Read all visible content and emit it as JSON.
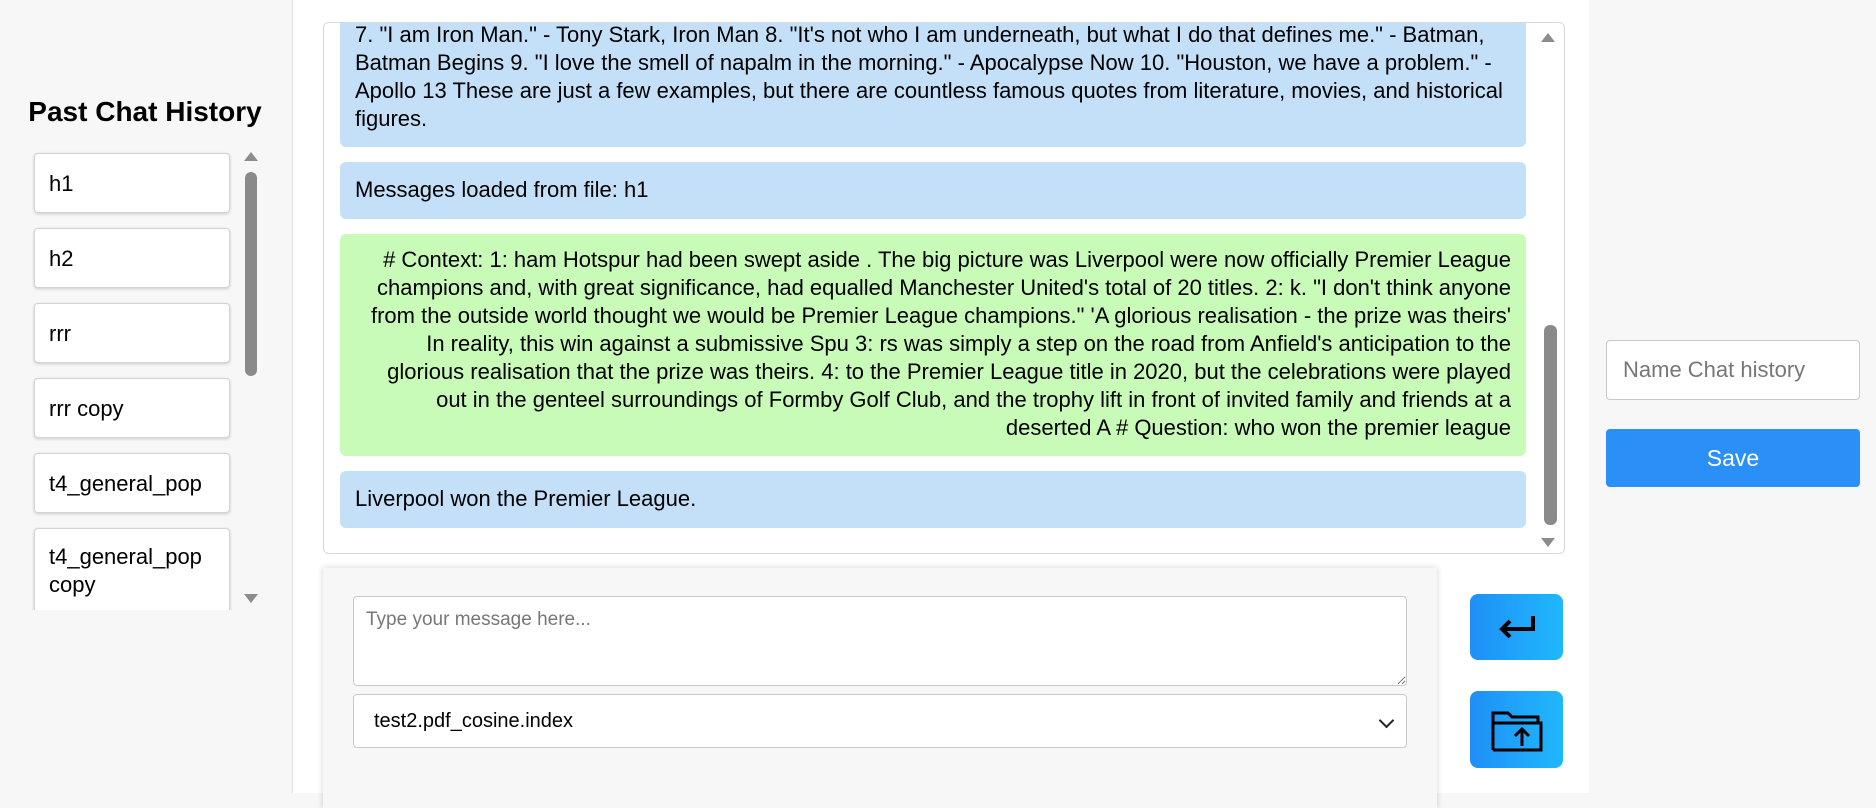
{
  "sidebar": {
    "title": "Past Chat History",
    "items": [
      {
        "label": "h1"
      },
      {
        "label": "h2"
      },
      {
        "label": "rrr"
      },
      {
        "label": "rrr copy"
      },
      {
        "label": "t4_general_pop"
      },
      {
        "label": "t4_general_pop copy"
      }
    ]
  },
  "chat": {
    "messages": [
      {
        "role": "bot",
        "text": "7. \"I am Iron Man.\" - Tony Stark, Iron Man 8. \"It's not who I am underneath, but what I do that defines me.\" - Batman, Batman Begins 9. \"I love the smell of napalm in the morning.\" - Apocalypse Now 10. \"Houston, we have a problem.\" - Apollo 13 These are just a few examples, but there are countless famous quotes from literature, movies, and historical figures."
      },
      {
        "role": "bot",
        "text": "Messages loaded from file: h1"
      },
      {
        "role": "user",
        "text": "# Context: 1: ham Hotspur had been swept aside . The big picture was Liverpool were now officially Premier League champions and, with great significance, had equalled Manchester United's total of 20 titles. 2: k. \"I don't think anyone from the outside world thought we would be Premier League champions.\" 'A glorious realisation - the prize was theirs' In reality, this win against a submissive Spu 3: rs was simply a step on the road from Anfield's anticipation to the glorious realisation that the prize was theirs. 4: to the Premier League title in 2020, but the celebrations were played out in the genteel surroundings of Formby Golf Club, and the trophy lift in front of invited family and friends at a deserted A # Question: who won the premier league"
      },
      {
        "role": "bot",
        "text": "Liverpool won the Premier League."
      }
    ]
  },
  "composer": {
    "placeholder": "Type your message here...",
    "selected_index": "test2.pdf_cosine.index",
    "send_icon": "enter-arrow-icon",
    "upload_icon": "folder-upload-icon",
    "accent_color": "#1f9bf9"
  },
  "right_panel": {
    "name_placeholder": "Name Chat history",
    "save_label": "Save",
    "save_color": "#2a8ff7"
  }
}
